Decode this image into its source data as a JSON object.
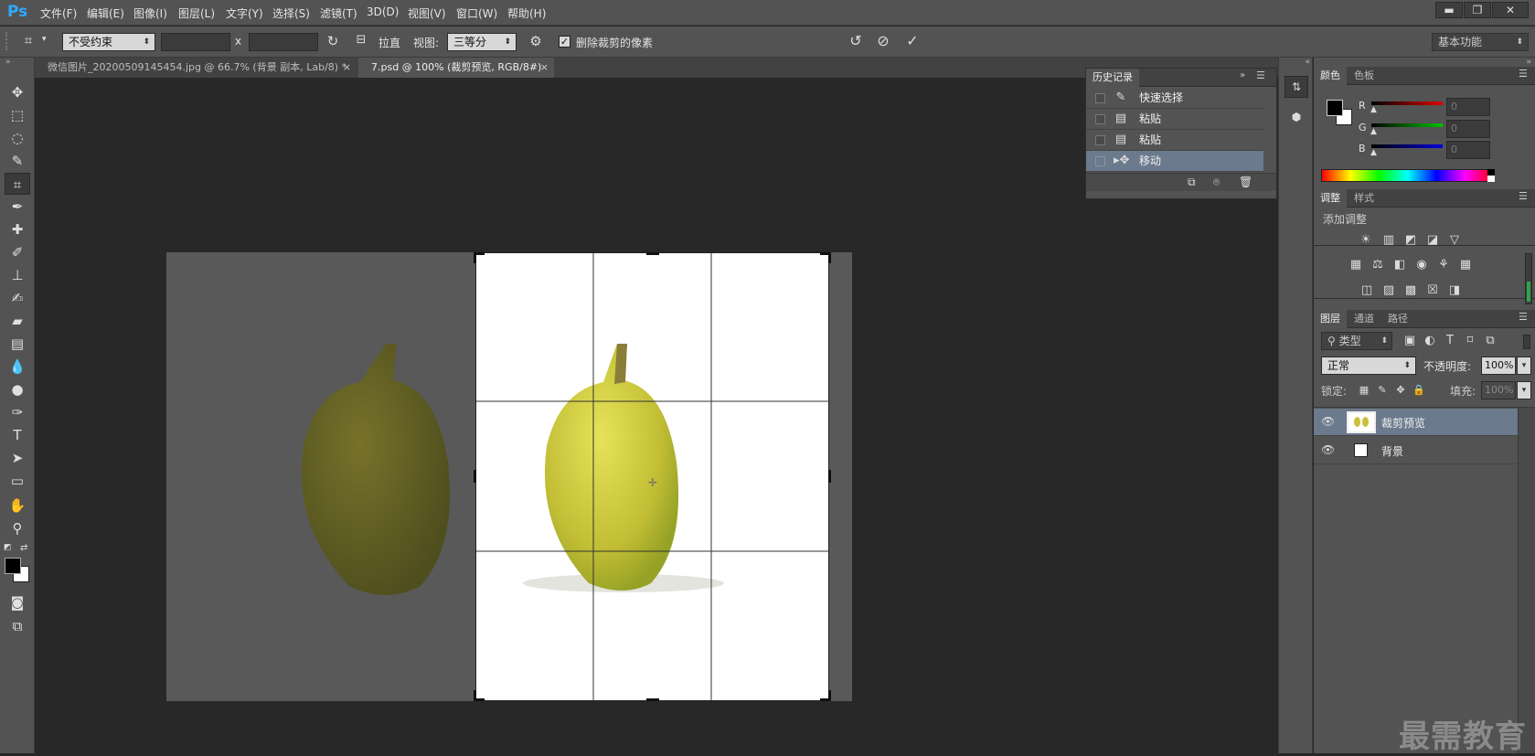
{
  "app": {
    "logo": "Ps"
  },
  "menu": [
    "文件(F)",
    "编辑(E)",
    "图像(I)",
    "图层(L)",
    "文字(Y)",
    "选择(S)",
    "滤镜(T)",
    "3D(D)",
    "视图(V)",
    "窗口(W)",
    "帮助(H)"
  ],
  "window_controls": {
    "minimize": "▬",
    "restore": "❐",
    "close": "✕"
  },
  "options": {
    "ratio": "不受约束",
    "x_sep": "x",
    "straighten": "拉直",
    "view_label": "视图:",
    "view_value": "三等分",
    "delete_pixels": "删除裁剪的像素",
    "workspace": "基本功能"
  },
  "tabs": [
    {
      "title": "微信图片_20200509145454.jpg @ 66.7% (背景 副本, Lab/8) *",
      "close": "×",
      "active": false
    },
    {
      "title": "7.psd @ 100% (裁剪预览, RGB/8#)",
      "close": "×",
      "active": true
    }
  ],
  "history": {
    "title": "历史记录",
    "items": [
      {
        "label": "快速选择",
        "icon": "quick-select-icon"
      },
      {
        "label": "粘贴",
        "icon": "document-icon"
      },
      {
        "label": "粘贴",
        "icon": "document-icon"
      },
      {
        "label": "移动",
        "icon": "move-icon"
      }
    ]
  },
  "color_panel": {
    "tabs": [
      "颜色",
      "色板"
    ],
    "channels": [
      {
        "label": "R",
        "value": "0",
        "color": "#e00000"
      },
      {
        "label": "G",
        "value": "0",
        "color": "#00c000"
      },
      {
        "label": "B",
        "value": "0",
        "color": "#0000e0"
      }
    ]
  },
  "adjust_panel": {
    "tabs": [
      "调整",
      "样式"
    ],
    "heading": "添加调整"
  },
  "layers_panel": {
    "tabs": [
      "图层",
      "通道",
      "路径"
    ],
    "filter": "类型",
    "blend_mode": "正常",
    "opacity_label": "不透明度:",
    "opacity_value": "100%",
    "lock_label": "锁定:",
    "fill_label": "填充:",
    "fill_value": "100%",
    "layers": [
      {
        "name": "裁剪预览",
        "active": true
      },
      {
        "name": "背景",
        "active": false
      }
    ]
  },
  "watermark": "最需教育",
  "colors": {
    "ui_bg": "#535353",
    "canvas_bg": "#282828",
    "accent": "#31a8ff",
    "selection": "#6b7a8d",
    "pear": "#c8c23a"
  }
}
